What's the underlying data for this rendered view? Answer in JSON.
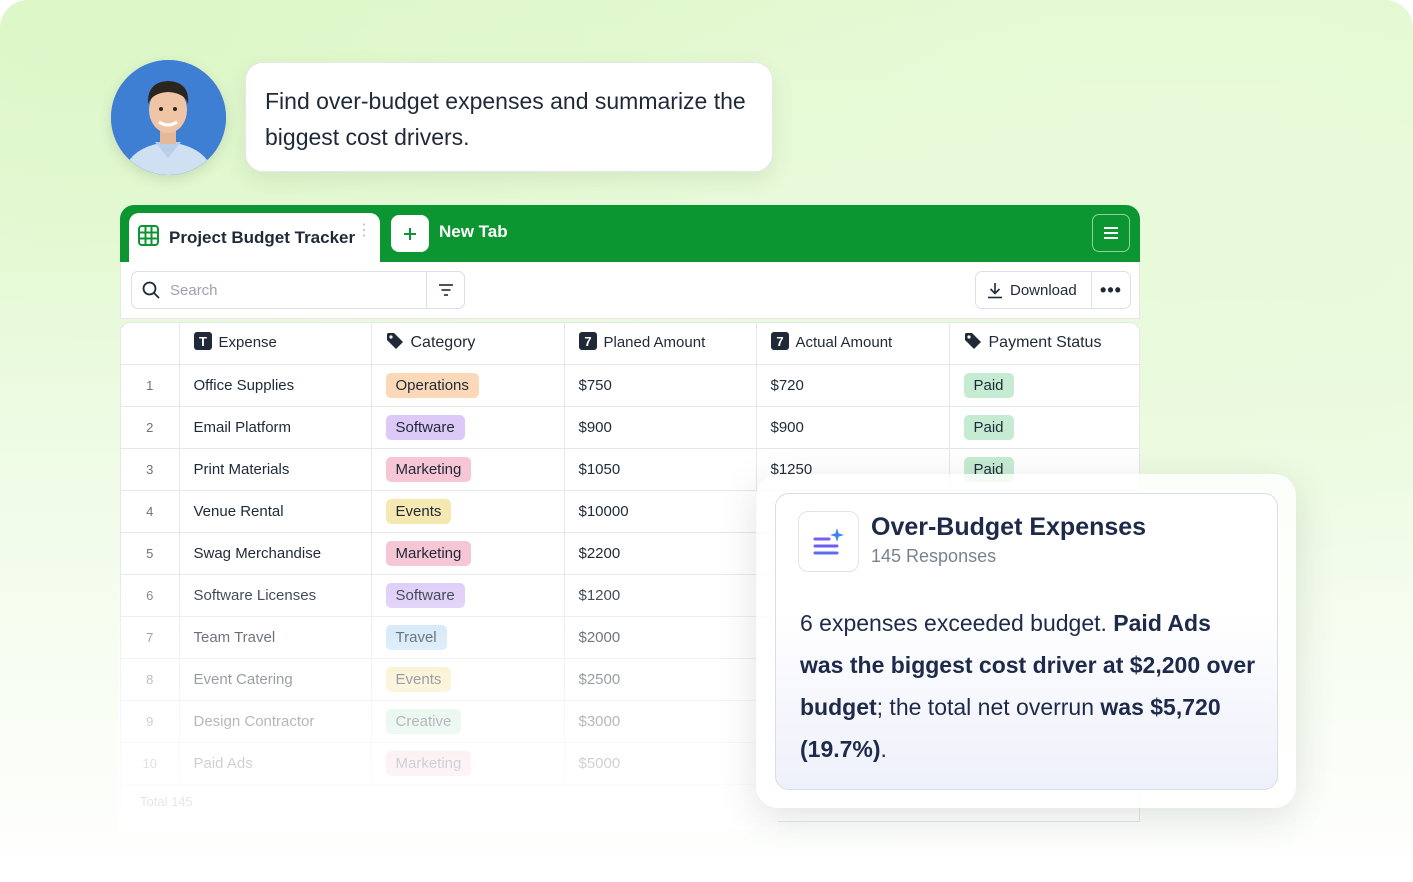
{
  "chat": {
    "message": "Find over-budget expenses and summarize the biggest cost drivers."
  },
  "sheet": {
    "active_tab": "Project Budget Tracker",
    "new_tab": "New Tab",
    "search_placeholder": "Search",
    "download_label": "Download",
    "more_label": "•••",
    "columns": [
      "Expense",
      "Category",
      "Planed Amount",
      "Actual Amount",
      "Payment Status"
    ],
    "rows": [
      {
        "num": "1",
        "expense": "Office Supplies",
        "category": "Operations",
        "planned": "$750",
        "actual": "$720",
        "status": "Paid"
      },
      {
        "num": "2",
        "expense": "Email Platform",
        "category": "Software",
        "planned": "$900",
        "actual": "$900",
        "status": "Paid"
      },
      {
        "num": "3",
        "expense": "Print Materials",
        "category": "Marketing",
        "planned": "$1050",
        "actual": "$1250",
        "status": "Paid"
      },
      {
        "num": "4",
        "expense": "Venue Rental",
        "category": "Events",
        "planned": "$10000",
        "actual": "",
        "status": ""
      },
      {
        "num": "5",
        "expense": "Swag Merchandise",
        "category": "Marketing",
        "planned": "$2200",
        "actual": "",
        "status": ""
      },
      {
        "num": "6",
        "expense": "Software Licenses",
        "category": "Software",
        "planned": "$1200",
        "actual": "",
        "status": ""
      },
      {
        "num": "7",
        "expense": "Team Travel",
        "category": "Travel",
        "planned": "$2000",
        "actual": "",
        "status": ""
      },
      {
        "num": "8",
        "expense": "Event Catering",
        "category": "Events",
        "planned": "$2500",
        "actual": "",
        "status": ""
      },
      {
        "num": "9",
        "expense": "Design Contractor",
        "category": "Creative",
        "planned": "$3000",
        "actual": "",
        "status": ""
      },
      {
        "num": "10",
        "expense": "Paid Ads",
        "category": "Marketing",
        "planned": "$5000",
        "actual": "",
        "status": ""
      }
    ],
    "ghost_footer": "Total 145",
    "colors": {
      "brand_green": "#0b9632",
      "Operations": {
        "bg": "#fbd9b8",
        "fg": "#1f2937"
      },
      "Software": {
        "bg": "#dcc9f7",
        "fg": "#1f2937"
      },
      "Marketing": {
        "bg": "#f6c6d4",
        "fg": "#1f2937"
      },
      "Events": {
        "bg": "#f6e8b1",
        "fg": "#1f2937"
      },
      "Travel": {
        "bg": "#c8e1f5",
        "fg": "#1f2937"
      },
      "Creative": {
        "bg": "#c7ecd6",
        "fg": "#1f2937"
      },
      "Paid": {
        "bg": "#c6ebd3",
        "fg": "#1f2937"
      }
    }
  },
  "result": {
    "title": "Over-Budget Expenses",
    "subtitle": "145 Responses",
    "body_parts": [
      {
        "text": "6 expenses exceeded budget. ",
        "bold": false
      },
      {
        "text": "Paid Ads was the biggest cost driver at $2,200 over budget",
        "bold": true
      },
      {
        "text": "; the total net overrun ",
        "bold": false
      },
      {
        "text": "was $5,720 (19.7%)",
        "bold": true
      },
      {
        "text": ".",
        "bold": false
      }
    ]
  }
}
